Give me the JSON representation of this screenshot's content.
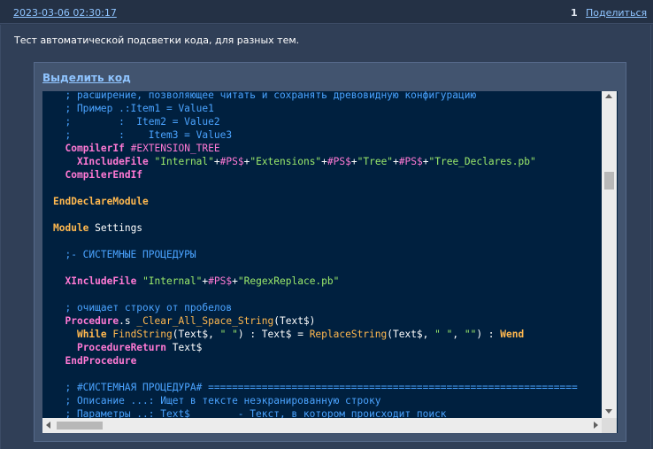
{
  "post": {
    "date": "2023-03-06 02:30:17",
    "number": "1",
    "share_label": "Поделиться",
    "text": "Тест автоматической подсветки кода, для разных тем."
  },
  "code_block": {
    "select_label": "Выделить код",
    "lines": [
      [
        {
          "c": "cm",
          "t": "  ; расширение, позволяющее читать и сохранять древовидную конфигурацию"
        }
      ],
      [
        {
          "c": "cm",
          "t": "  ; Пример .:Item1 = Value1"
        }
      ],
      [
        {
          "c": "cm",
          "t": "  ;        :  Item2 = Value2"
        }
      ],
      [
        {
          "c": "cm",
          "t": "  ;        :    Item3 = Value3"
        }
      ],
      [
        {
          "c": "tx",
          "t": "  "
        },
        {
          "c": "pp",
          "t": "CompilerIf"
        },
        {
          "c": "tx",
          "t": " "
        },
        {
          "c": "co",
          "t": "#EXTENSION_TREE"
        }
      ],
      [
        {
          "c": "tx",
          "t": "    "
        },
        {
          "c": "pp",
          "t": "XIncludeFile"
        },
        {
          "c": "tx",
          "t": " "
        },
        {
          "c": "st",
          "t": "\"Internal\""
        },
        {
          "c": "tx",
          "t": "+"
        },
        {
          "c": "co",
          "t": "#PS$"
        },
        {
          "c": "tx",
          "t": "+"
        },
        {
          "c": "st",
          "t": "\"Extensions\""
        },
        {
          "c": "tx",
          "t": "+"
        },
        {
          "c": "co",
          "t": "#PS$"
        },
        {
          "c": "tx",
          "t": "+"
        },
        {
          "c": "st",
          "t": "\"Tree\""
        },
        {
          "c": "tx",
          "t": "+"
        },
        {
          "c": "co",
          "t": "#PS$"
        },
        {
          "c": "tx",
          "t": "+"
        },
        {
          "c": "st",
          "t": "\"Tree_Declares.pb\""
        }
      ],
      [
        {
          "c": "tx",
          "t": "  "
        },
        {
          "c": "pp",
          "t": "CompilerEndIf"
        }
      ],
      [],
      [
        {
          "c": "kw",
          "t": "EndDeclareModule"
        }
      ],
      [],
      [
        {
          "c": "kw",
          "t": "Module"
        },
        {
          "c": "tx",
          "t": " Settings"
        }
      ],
      [],
      [
        {
          "c": "cm",
          "t": "  ;- СИСТЕМНЫЕ ПРОЦЕДУРЫ"
        }
      ],
      [],
      [
        {
          "c": "tx",
          "t": "  "
        },
        {
          "c": "pp",
          "t": "XIncludeFile"
        },
        {
          "c": "tx",
          "t": " "
        },
        {
          "c": "st",
          "t": "\"Internal\""
        },
        {
          "c": "tx",
          "t": "+"
        },
        {
          "c": "co",
          "t": "#PS$"
        },
        {
          "c": "tx",
          "t": "+"
        },
        {
          "c": "st",
          "t": "\"RegexReplace.pb\""
        }
      ],
      [],
      [
        {
          "c": "cm",
          "t": "  ; очищает строку от пробелов"
        }
      ],
      [
        {
          "c": "tx",
          "t": "  "
        },
        {
          "c": "pp",
          "t": "Procedure"
        },
        {
          "c": "tx",
          "t": ".s "
        },
        {
          "c": "fn",
          "t": "_Clear_All_Space_String"
        },
        {
          "c": "tx",
          "t": "(Text$)"
        }
      ],
      [
        {
          "c": "tx",
          "t": "    "
        },
        {
          "c": "kw",
          "t": "While"
        },
        {
          "c": "tx",
          "t": " "
        },
        {
          "c": "fn",
          "t": "FindString"
        },
        {
          "c": "tx",
          "t": "(Text$, "
        },
        {
          "c": "st",
          "t": "\" \""
        },
        {
          "c": "tx",
          "t": ") : Text$ = "
        },
        {
          "c": "fn",
          "t": "ReplaceString"
        },
        {
          "c": "tx",
          "t": "(Text$, "
        },
        {
          "c": "st",
          "t": "\" \""
        },
        {
          "c": "tx",
          "t": ", "
        },
        {
          "c": "st",
          "t": "\"\""
        },
        {
          "c": "tx",
          "t": ") : "
        },
        {
          "c": "kw",
          "t": "Wend"
        }
      ],
      [
        {
          "c": "tx",
          "t": "    "
        },
        {
          "c": "pp",
          "t": "ProcedureReturn"
        },
        {
          "c": "tx",
          "t": " Text$"
        }
      ],
      [
        {
          "c": "tx",
          "t": "  "
        },
        {
          "c": "pp",
          "t": "EndProcedure"
        }
      ],
      [],
      [
        {
          "c": "cm",
          "t": "  ; #СИСТЕМНАЯ ПРОЦЕДУРА# =============================================================="
        }
      ],
      [
        {
          "c": "cm",
          "t": "  ; Описание ...: Ищет в тексте неэкранированную строку"
        }
      ],
      [
        {
          "c": "cm",
          "t": "  ; Параметры ..: Text$        - Текст, в котором происходит поиск"
        }
      ]
    ]
  },
  "colors": {
    "background": "#2e3d54",
    "code_background": "#00203f",
    "link": "#8fc4ff",
    "comment": "#4aa3ff",
    "keyword": "#ffb84f",
    "directive": "#ff79d4",
    "string": "#9bea6b"
  }
}
